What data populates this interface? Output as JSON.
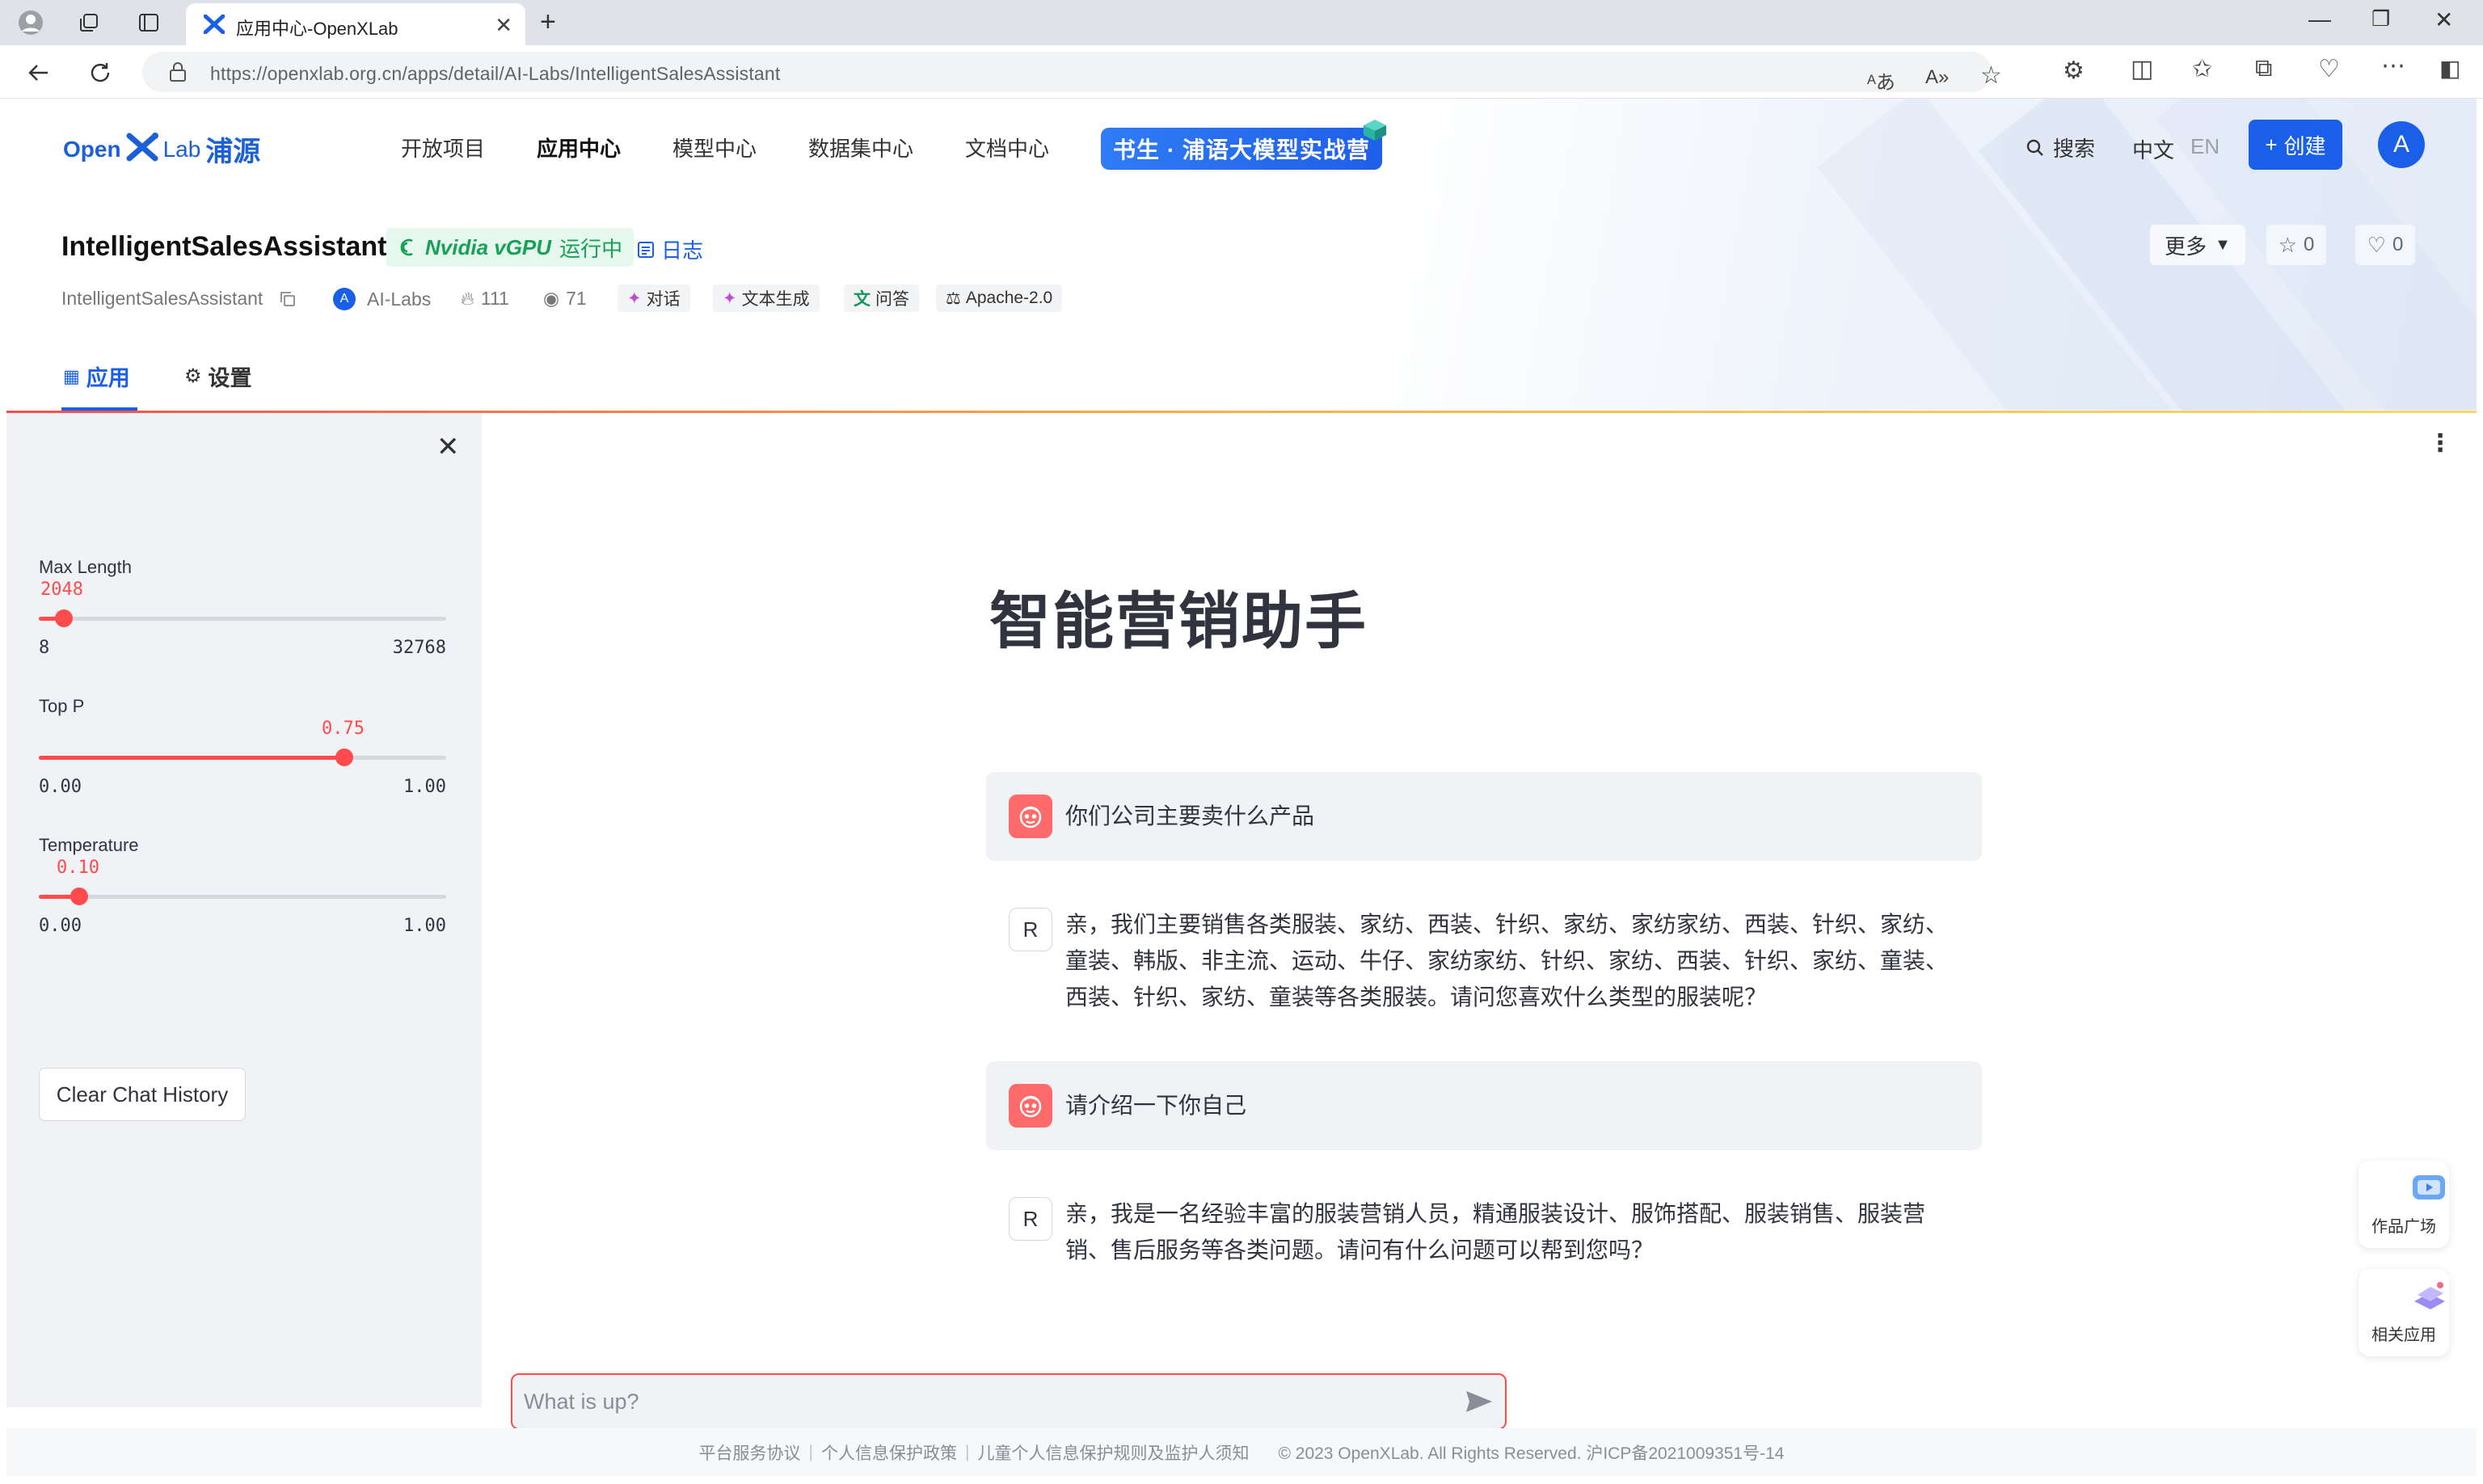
{
  "browser": {
    "tab_title": "应用中心-OpenXLab",
    "url_host": "https://openxlab.org.cn",
    "url_path": "/apps/detail/AI-Labs/IntelligentSalesAssistant"
  },
  "site": {
    "logo_open": "Open",
    "logo_lab": "Lab",
    "logo_cn": "浦源",
    "nav": [
      "开放项目",
      "应用中心",
      "模型中心",
      "数据集中心",
      "文档中心"
    ],
    "camp_label": "书生 · 浦语大模型实战营",
    "search_label": "搜索",
    "lang_zh": "中文",
    "lang_en": "EN",
    "create_label": "创建",
    "avatar_letter": "A"
  },
  "app": {
    "title": "IntelligentSalesAssistant",
    "gpu": "Nvidia vGPU",
    "status": "运行中",
    "log_label": "日志",
    "more_label": "更多",
    "stars": "0",
    "likes": "0",
    "repo_name": "IntelligentSalesAssistant",
    "owner_initial": "A",
    "owner": "AI-Labs",
    "hot": "111",
    "views": "71",
    "tags": [
      "对话",
      "文本生成",
      "问答",
      "Apache-2.0"
    ],
    "tab_app": "应用",
    "tab_settings": "设置"
  },
  "sidebar": {
    "max_length": {
      "label": "Max Length",
      "value": "2048",
      "min": "8",
      "max": "32768",
      "fraction": 0.062
    },
    "top_p": {
      "label": "Top P",
      "value": "0.75",
      "min": "0.00",
      "max": "1.00",
      "fraction": 0.75
    },
    "temperature": {
      "label": "Temperature",
      "value": "0.10",
      "min": "0.00",
      "max": "1.00",
      "fraction": 0.1
    },
    "clear_label": "Clear Chat History"
  },
  "chat": {
    "title": "智能营销助手",
    "messages": [
      {
        "role": "user",
        "text": "你们公司主要卖什么产品"
      },
      {
        "role": "assistant",
        "avatar": "R",
        "text": "亲，我们主要销售各类服装、家纺、西装、针织、家纺、家纺家纺、西装、针织、家纺、童装、韩版、非主流、运动、牛仔、家纺家纺、针织、家纺、西装、针织、家纺、童装、西装、针织、家纺、童装等各类服装。请问您喜欢什么类型的服装呢？"
      },
      {
        "role": "user",
        "text": "请介绍一下你自己"
      },
      {
        "role": "assistant",
        "avatar": "R",
        "text": "亲，我是一名经验丰富的服装营销人员，精通服装设计、服饰搭配、服装销售、服装营销、售后服务等各类问题。请问有什么问题可以帮到您吗？"
      }
    ],
    "input_placeholder": "What is up?"
  },
  "float": {
    "works": "作品广场",
    "related": "相关应用"
  },
  "footer": {
    "links": [
      "平台服务协议",
      "个人信息保护政策",
      "儿童个人信息保护规则及监护人须知"
    ],
    "copyright": "© 2023 OpenXLab. All Rights Reserved. 沪ICP备2021009351号-14"
  },
  "colors": {
    "brand": "#1a5fe8",
    "accent": "#ff4b4b",
    "running": "#17a058"
  }
}
